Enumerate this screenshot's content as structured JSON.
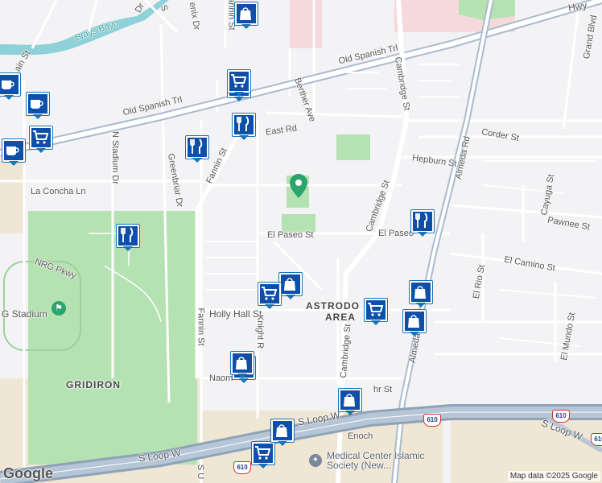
{
  "map": {
    "attribution": "Map data ©2025 Google",
    "logo": "Google",
    "colors": {
      "background": "#f3f3f6",
      "park": "#b5e2b2",
      "road": "#ffffff",
      "highway": "#a9bbcf",
      "water": "#8fd1d8",
      "marker": "#0f4fa8",
      "pin": "#2aa56d"
    },
    "street_labels": {
      "old_spanish_trl_1": "Old Spanish Trl",
      "old_spanish_trl_2": "Old Spanish Trl",
      "east_rd": "East Rd",
      "berther_ave": "Berther Ave",
      "cambridge_st_1": "Cambridge St",
      "cambridge_st_2": "Cambridge St",
      "cambridge_st_3": "Cambridge St",
      "corder_st": "Corder St",
      "hepburn_st": "Hepburn St",
      "almeda_rd_1": "Almeda Rd",
      "almeda_rd_2": "Almeda Rd",
      "cayuga_st": "Cayuga St",
      "pawnee_st": "Pawnee St",
      "grand_blvd": "Grand Blvd",
      "el_paseo_st_1": "El Paseo St",
      "el_paseo_st_2": "El Paseo",
      "el_camino_st": "El Camino St",
      "el_rio_st": "El Rio St",
      "el_mundo_st": "El Mundo St",
      "la_concha_ln": "La Concha Ln",
      "n_stadium_dr": "N Stadium Dr",
      "greenbriar_dr": "Greenbriar Dr",
      "fannin_st_1": "Fannin St",
      "fannin_st_2": "Fannin St",
      "nrg_pkwy": "NRG Pkwy",
      "holly_hall_st": "Holly Hall St",
      "knight_rd": "Knight R",
      "naomi": "Naom",
      "hr_st": "hr St",
      "s_loop_w_1": "S Loop W",
      "s_loop_w_2": "S Loop W",
      "s_loop_w_3": "S Loop W",
      "enoch": "Enoch",
      "hwy_partial": "Hwy",
      "main_st": "ain St",
      "brays_bayou": "Brays Bayo",
      "top_dr": "Dr",
      "top_s": "S",
      "top_fannin": "Fannin St",
      "top_phenix": "enix Dr",
      "s_partial": "S U"
    },
    "area_labels": {
      "astrodome_1": "ASTRODO",
      "astrodome_2": "AREA",
      "gridiron": "GRIDIRON",
      "nrg_stadium": "G Stadium"
    },
    "poi_labels": {
      "islamic_society": "Medical Center Islamic Society (New..."
    },
    "route_shields": [
      "610",
      "610",
      "610",
      "610"
    ],
    "markers": [
      {
        "type": "shopping-bag",
        "icon": "bag-icon"
      },
      {
        "type": "coffee",
        "icon": "coffee-icon"
      },
      {
        "type": "coffee",
        "icon": "coffee-icon"
      },
      {
        "type": "coffee",
        "icon": "coffee-icon"
      },
      {
        "type": "cart",
        "icon": "cart-icon"
      },
      {
        "type": "cart",
        "icon": "cart-icon"
      },
      {
        "type": "restaurant",
        "icon": "fork-knife-icon"
      },
      {
        "type": "restaurant",
        "icon": "fork-knife-icon"
      },
      {
        "type": "restaurant",
        "icon": "fork-knife-icon"
      },
      {
        "type": "restaurant",
        "icon": "fork-knife-icon"
      },
      {
        "type": "shopping-bag",
        "icon": "bag-icon"
      },
      {
        "type": "cart",
        "icon": "cart-icon"
      },
      {
        "type": "cart",
        "icon": "cart-icon"
      },
      {
        "type": "shopping-bag",
        "icon": "bag-icon"
      },
      {
        "type": "shopping-bag",
        "icon": "bag-icon"
      },
      {
        "type": "shopping-bag",
        "icon": "bag-icon"
      },
      {
        "type": "cart",
        "icon": "cart-icon"
      },
      {
        "type": "shopping-bag",
        "icon": "bag-icon"
      },
      {
        "type": "shopping-bag",
        "icon": "bag-icon"
      },
      {
        "type": "shopping-bag",
        "icon": "bag-icon"
      },
      {
        "type": "cart",
        "icon": "cart-icon"
      }
    ]
  }
}
